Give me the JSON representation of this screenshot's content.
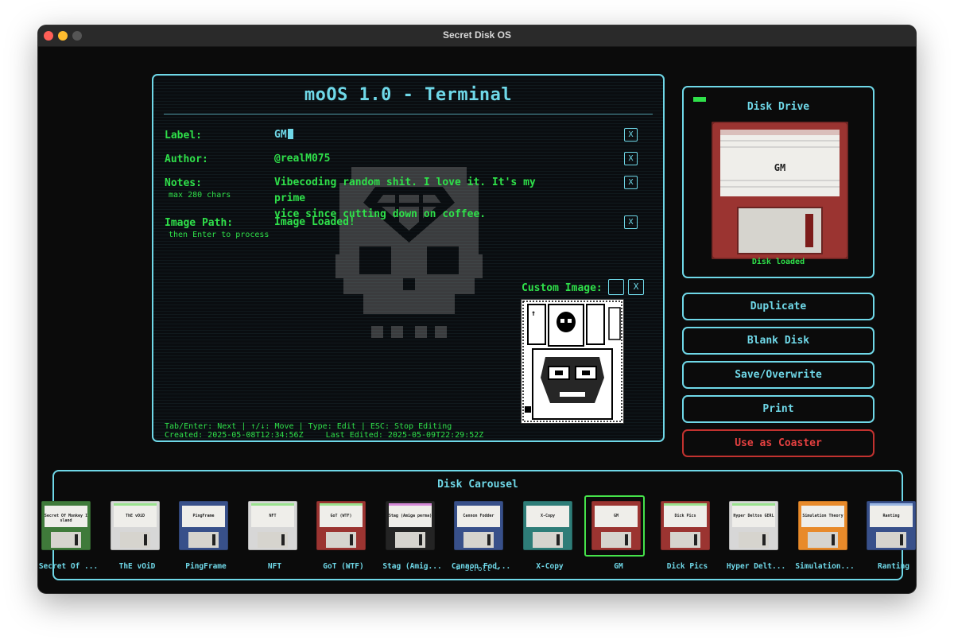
{
  "window": {
    "title": "Secret Disk OS"
  },
  "terminal": {
    "title": "moOS 1.0 - Terminal",
    "fields": [
      {
        "label": "Label:",
        "sublabel": "",
        "value": "GM",
        "value2": ""
      },
      {
        "label": "Author:",
        "sublabel": "",
        "value": "@realM075",
        "value2": ""
      },
      {
        "label": "Notes:",
        "sublabel": "max 280 chars",
        "value": "Vibecoding random shit. I love it. It's my prime",
        "value2": "vice since cutting down on coffee."
      },
      {
        "label": "Image Path:",
        "sublabel": "then Enter to process",
        "value": "Image Loaded!",
        "value2": ""
      }
    ],
    "clear_label": "X",
    "custom_image_label": "Custom Image:",
    "help_text": "Tab/Enter: Next | ↑/↓: Move | Type: Edit | ESC: Stop Editing",
    "created": "Created: 2025-05-08T12:34:56Z",
    "last_edited": "Last Edited: 2025-05-09T22:29:52Z"
  },
  "drive": {
    "title": "Disk Drive",
    "disk_label": "GM",
    "status": "Disk loaded",
    "disk_color": "#9b3431"
  },
  "actions": {
    "duplicate": "Duplicate",
    "blank": "Blank Disk",
    "save": "Save/Overwrite",
    "print": "Print",
    "coaster": "Use as Coaster"
  },
  "carousel": {
    "title": "Disk Carousel",
    "scroll_hint": "← Scroll →",
    "selected_index": 8,
    "disks": [
      {
        "label": "Secret Of Monkey Island",
        "caption": "Secret Of ...",
        "color": "#3f7a3a",
        "stripe": "#3f7a3a"
      },
      {
        "label": "ThE vOiD",
        "caption": "ThE vOiD",
        "color": "#d7d7d7",
        "stripe": "#9be28f"
      },
      {
        "label": "PingFrame",
        "caption": "PingFrame",
        "color": "#38508a",
        "stripe": "#38508a"
      },
      {
        "label": "NFT",
        "caption": "NFT",
        "color": "#d7d7d7",
        "stripe": "#9be28f"
      },
      {
        "label": "GoT (WTF)",
        "caption": "GoT (WTF)",
        "color": "#9b3431",
        "stripe": "#9be28f"
      },
      {
        "label": "Stag (Amiga perma)",
        "caption": "Stag (Amig...",
        "color": "#242424",
        "stripe": "#d58ad8"
      },
      {
        "label": "Cannon Fodder",
        "caption": "Cannon Fod...",
        "color": "#38508a",
        "stripe": "#38508a"
      },
      {
        "label": "X-Copy",
        "caption": "X-Copy",
        "color": "#2e7d78",
        "stripe": "#2e7d78"
      },
      {
        "label": "GM",
        "caption": "GM",
        "color": "#9b3431",
        "stripe": "#9b3431"
      },
      {
        "label": "Dick Pics",
        "caption": "Dick Pics",
        "color": "#9b3431",
        "stripe": "#9be28f"
      },
      {
        "label": "Hyper Deltos GERL",
        "caption": "Hyper Delt...",
        "color": "#d7d7d7",
        "stripe": "#9be28f"
      },
      {
        "label": "Simulation Theory",
        "caption": "Simulation...",
        "color": "#e88a2a",
        "stripe": "#e88a2a"
      },
      {
        "label": "Ranting",
        "caption": "Ranting",
        "color": "#38508a",
        "stripe": "#9ab6e2"
      }
    ]
  }
}
